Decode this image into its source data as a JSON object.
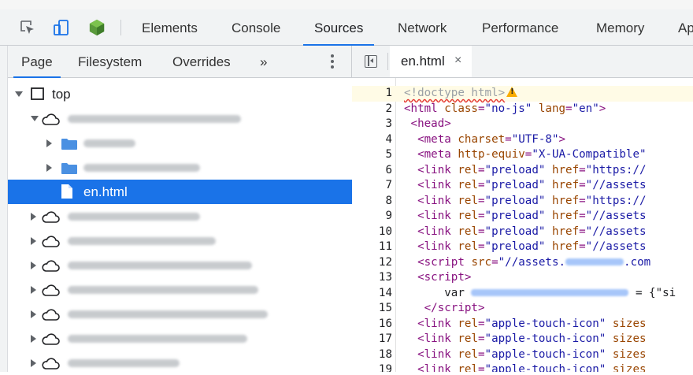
{
  "toolbar": {
    "tabs": [
      "Elements",
      "Console",
      "Sources",
      "Network",
      "Performance",
      "Memory",
      "Ap"
    ],
    "active_tab": "Sources",
    "icons": [
      "inspect-element-icon",
      "device-toolbar-icon",
      "extension-cube-icon"
    ],
    "accent_color": "#1a73e8"
  },
  "navigator": {
    "tabs": [
      "Page",
      "Filesystem",
      "Overrides"
    ],
    "active_tab": "Page",
    "more_label": "»",
    "tree": {
      "top_label": "top",
      "selected_file": "en.html"
    }
  },
  "editor": {
    "open_file": "en.html",
    "close_label": "×",
    "lines": [
      {
        "n": "1",
        "html": "<span class='t-doc'>&lt;!doctype html&gt;</span><span class='warn-icon' data-name='warning-icon'></span>"
      },
      {
        "n": "2",
        "html": "<span class='t-tag'>&lt;html</span> <span class='t-attr'>class</span><span class='t-tag'>=</span><span class='t-val'>\"no-js\"</span> <span class='t-attr'>lang</span><span class='t-tag'>=</span><span class='t-val'>\"en\"</span><span class='t-tag'>&gt;</span>"
      },
      {
        "n": "3",
        "html": " <span class='t-tag'>&lt;head&gt;</span>"
      },
      {
        "n": "4",
        "html": "  <span class='t-tag'>&lt;meta</span> <span class='t-attr'>charset</span><span class='t-tag'>=</span><span class='t-val'>\"UTF-8\"</span><span class='t-tag'>&gt;</span>"
      },
      {
        "n": "5",
        "html": "  <span class='t-tag'>&lt;meta</span> <span class='t-attr'>http-equiv</span><span class='t-tag'>=</span><span class='t-val'>\"X-UA-Compatible\"</span>"
      },
      {
        "n": "6",
        "html": "  <span class='t-tag'>&lt;link</span> <span class='t-attr'>rel</span><span class='t-tag'>=</span><span class='t-val'>\"preload\"</span> <span class='t-attr'>href</span><span class='t-tag'>=</span><span class='t-val'>\"https://</span>"
      },
      {
        "n": "7",
        "html": "  <span class='t-tag'>&lt;link</span> <span class='t-attr'>rel</span><span class='t-tag'>=</span><span class='t-val'>\"preload\"</span> <span class='t-attr'>href</span><span class='t-tag'>=</span><span class='t-val'>\"//assets</span>"
      },
      {
        "n": "8",
        "html": "  <span class='t-tag'>&lt;link</span> <span class='t-attr'>rel</span><span class='t-tag'>=</span><span class='t-val'>\"preload\"</span> <span class='t-attr'>href</span><span class='t-tag'>=</span><span class='t-val'>\"https://</span>"
      },
      {
        "n": "9",
        "html": "  <span class='t-tag'>&lt;link</span> <span class='t-attr'>rel</span><span class='t-tag'>=</span><span class='t-val'>\"preload\"</span> <span class='t-attr'>href</span><span class='t-tag'>=</span><span class='t-val'>\"//assets</span>"
      },
      {
        "n": "10",
        "html": "  <span class='t-tag'>&lt;link</span> <span class='t-attr'>rel</span><span class='t-tag'>=</span><span class='t-val'>\"preload\"</span> <span class='t-attr'>href</span><span class='t-tag'>=</span><span class='t-val'>\"//assets</span>"
      },
      {
        "n": "11",
        "html": "  <span class='t-tag'>&lt;link</span> <span class='t-attr'>rel</span><span class='t-tag'>=</span><span class='t-val'>\"preload\"</span> <span class='t-attr'>href</span><span class='t-tag'>=</span><span class='t-val'>\"//assets</span>"
      },
      {
        "n": "12",
        "html": "  <span class='t-tag'>&lt;script</span> <span class='t-attr'>src</span><span class='t-tag'>=</span><span class='t-val'>\"//assets.<span class='t-obs' style='width:74px'></span>.com</span>"
      },
      {
        "n": "13",
        "html": "  <span class='t-tag'>&lt;script&gt;</span>"
      },
      {
        "n": "14",
        "html": "      <span class='t-text'>var <span class='t-obs' style='width:200px'></span> = {\"si</span>"
      },
      {
        "n": "15",
        "html": "   <span class='t-tag'>&lt;/script&gt;</span>"
      },
      {
        "n": "16",
        "html": "  <span class='t-tag'>&lt;link</span> <span class='t-attr'>rel</span><span class='t-tag'>=</span><span class='t-val'>\"apple-touch-icon\"</span> <span class='t-attr'>sizes</span>"
      },
      {
        "n": "17",
        "html": "  <span class='t-tag'>&lt;link</span> <span class='t-attr'>rel</span><span class='t-tag'>=</span><span class='t-val'>\"apple-touch-icon\"</span> <span class='t-attr'>sizes</span>"
      },
      {
        "n": "18",
        "html": "  <span class='t-tag'>&lt;link</span> <span class='t-attr'>rel</span><span class='t-tag'>=</span><span class='t-val'>\"apple-touch-icon\"</span> <span class='t-attr'>sizes</span>"
      },
      {
        "n": "19",
        "html": "  <span class='t-tag'>&lt;link</span> <span class='t-attr'>rel</span><span class='t-tag'>=</span><span class='t-val'>\"apple-touch-icon\"</span> <span class='t-attr'>sizes</span>"
      }
    ]
  }
}
